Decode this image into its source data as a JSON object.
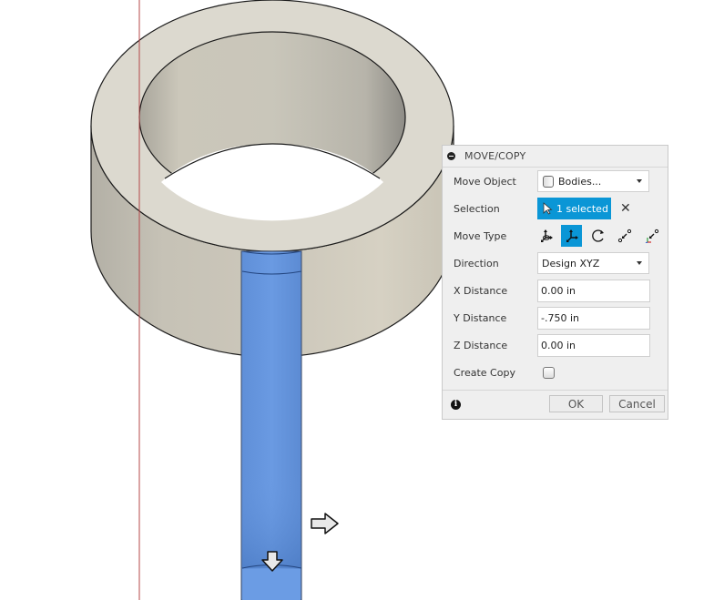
{
  "viewport": {
    "colors": {
      "ring_top": "#dcd9cf",
      "ring_side_light": "#d2cdbf",
      "ring_side_dark": "#b8b5aa",
      "selected_body": "#6a9be2",
      "axis_line": "#b5484a",
      "background": "#ffffff"
    },
    "manipulators": [
      {
        "name": "x-direction-arrow",
        "direction": "right"
      },
      {
        "name": "y-direction-arrow",
        "direction": "down"
      }
    ]
  },
  "dialog": {
    "title": "MOVE/COPY",
    "move_object": {
      "label": "Move Object",
      "value": "Bodies..."
    },
    "selection": {
      "label": "Selection",
      "value": "1 selected"
    },
    "move_type": {
      "label": "Move Type",
      "options": [
        "free-move",
        "translate-xyz",
        "rotate",
        "point-to-point",
        "point-to-position"
      ],
      "active": "translate-xyz"
    },
    "direction": {
      "label": "Direction",
      "value": "Design XYZ"
    },
    "x_distance": {
      "label": "X Distance",
      "value": "0.00 in"
    },
    "y_distance": {
      "label": "Y Distance",
      "value": "-.750 in"
    },
    "z_distance": {
      "label": "Z Distance",
      "value": "0.00 in"
    },
    "create_copy": {
      "label": "Create Copy",
      "checked": false
    },
    "ok_label": "OK",
    "cancel_label": "Cancel",
    "accent": "#0a96d6"
  }
}
